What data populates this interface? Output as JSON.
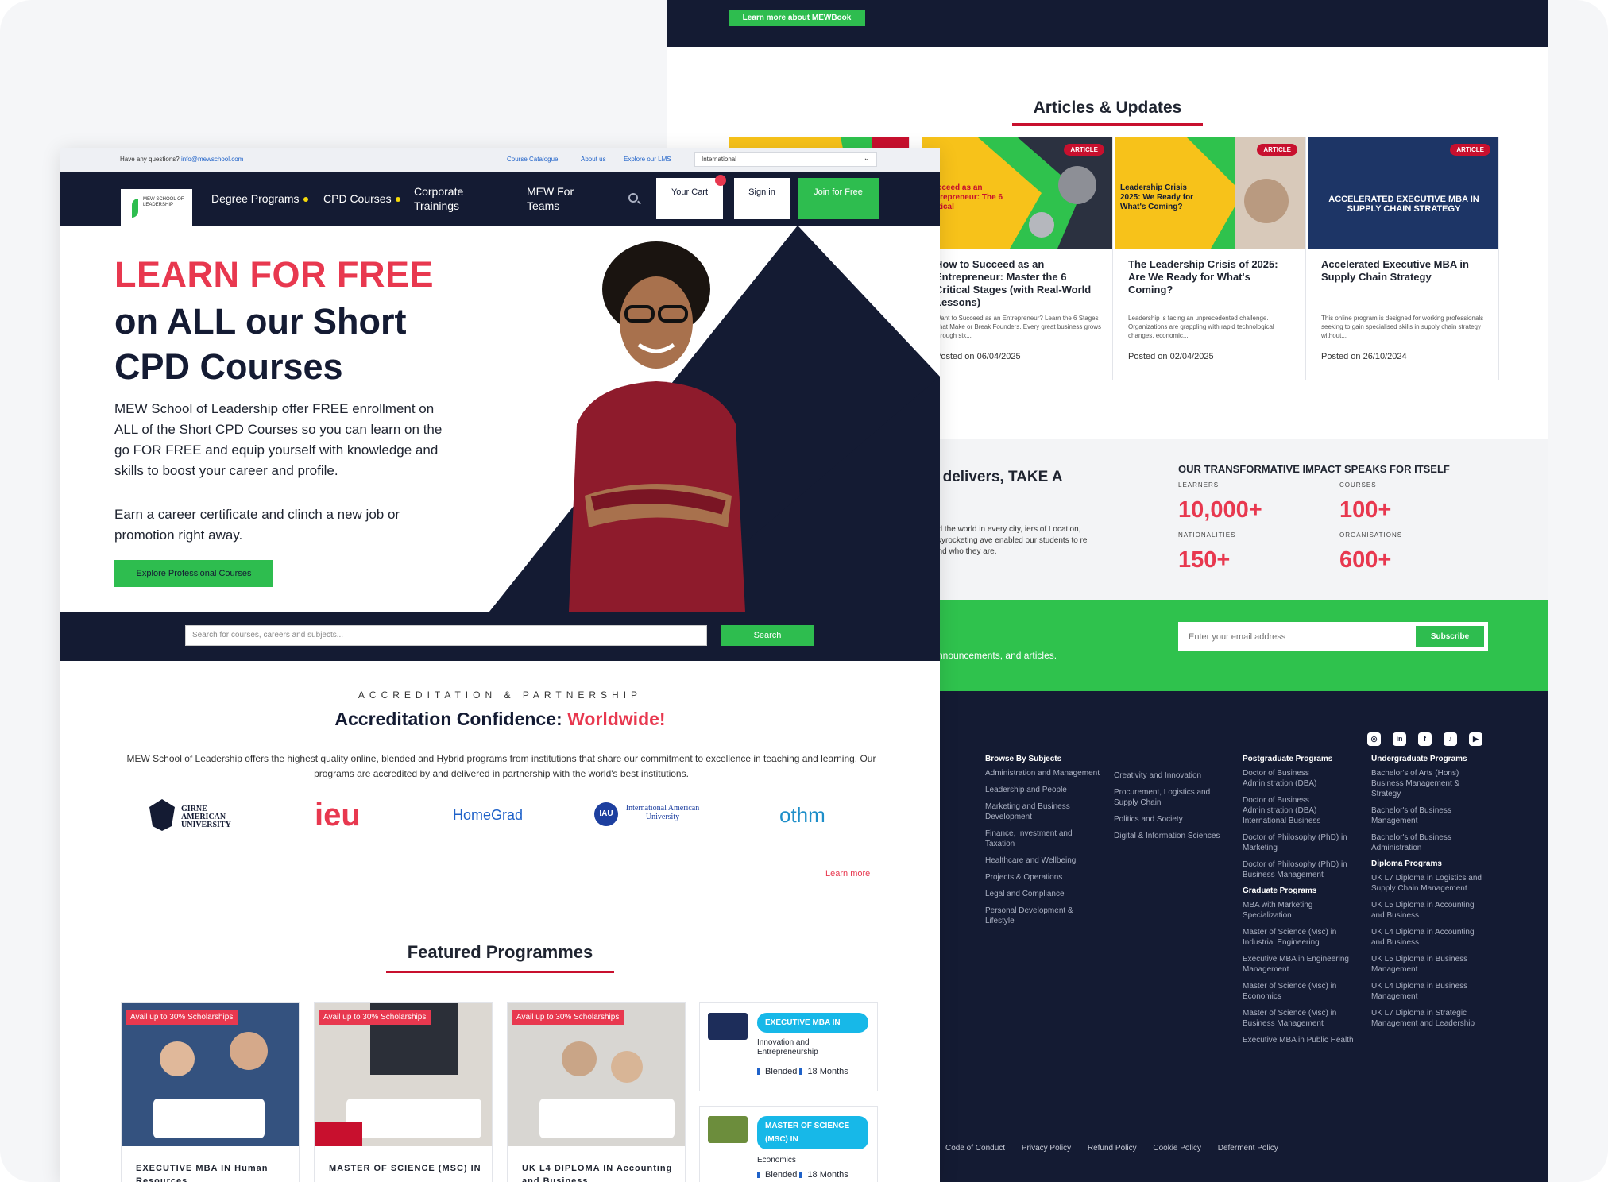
{
  "back_page": {
    "top_button": "Learn more about MEWBook",
    "articles_title": "Articles & Updates",
    "articles": [
      {
        "badge": "ARTICLE",
        "overlay": "Succeed as an Entrepreneur: The 6 Critical",
        "title": "How to Succeed as an Entrepreneur: Master the 6 Critical Stages (with Real-World Lessons)",
        "excerpt": "Want to Succeed as an Entrepreneur? Learn the 6 Stages That Make or Break Founders. Every great business grows through six...",
        "date": "Posted on 06/04/2025"
      },
      {
        "badge": "ARTICLE",
        "overlay": "Leadership Crisis 2025: We Ready for What's Coming?",
        "title": "The Leadership Crisis of 2025: Are We Ready for What's Coming?",
        "excerpt": "Leadership is facing an unprecedented challenge. Organizations are grappling with rapid technological changes, economic...",
        "date": "Posted on 02/04/2025"
      },
      {
        "badge": "ARTICLE",
        "overlay": "ACCELERATED EXECUTIVE MBA IN SUPPLY CHAIN STRATEGY",
        "title": "Accelerated Executive MBA in Supply Chain Strategy",
        "excerpt": "This online program is designed for working professionals seeking to gain specialised skills in supply chain strategy without...",
        "date": "Posted on 26/10/2024"
      }
    ],
    "impact_left_title": "t delivers, TAKE A",
    "impact_left_desc": "nd the world in every city, iers of Location, skyrocketing ave enabled our students to re and who they are.",
    "impact_title": "OUR TRANSFORMATIVE IMPACT SPEAKS FOR ITSELF",
    "stats": [
      {
        "label": "LEARNERS",
        "value": "10,000+"
      },
      {
        "label": "COURSES",
        "value": "100+"
      },
      {
        "label": "NATIONALITIES",
        "value": "150+"
      },
      {
        "label": "ORGANISATIONS",
        "value": "600+"
      }
    ],
    "newsletter_left": "nnouncements, and articles.",
    "newsletter_placeholder": "Enter your email address",
    "newsletter_button": "Subscribe",
    "social_icons": [
      "instagram-icon",
      "linkedin-icon",
      "facebook-icon",
      "tiktok-icon",
      "youtube-icon"
    ],
    "footer": {
      "subjects_title": "Browse By Subjects",
      "subjects_col1": [
        "Administration and Management",
        "Leadership and People",
        "Marketing and Business Development",
        "Finance, Investment and Taxation",
        "Healthcare and Wellbeing",
        "Projects & Operations",
        "Legal and Compliance",
        "Personal Development & Lifestyle"
      ],
      "subjects_col2": [
        "Creativity and Innovation",
        "Procurement, Logistics and Supply Chain",
        "Politics and Society",
        "Digital & Information Sciences"
      ],
      "postgrad_title": "Postgraduate Programs",
      "postgrad": [
        "Doctor of Business Administration (DBA)",
        "Doctor of Business Administration (DBA) International Business",
        "Doctor of Philosophy (PhD) in Marketing",
        "Doctor of Philosophy (PhD) in Business Management"
      ],
      "grad_title": "Graduate Programs",
      "grad": [
        "MBA with Marketing Specialization",
        "Master of Science (Msc) in Industrial Engineering",
        "Executive MBA in Engineering Management",
        "Master of Science (Msc) in Economics",
        "Master of Science (Msc) in Business Management",
        "Executive MBA in Public Health"
      ],
      "undergrad_title": "Undergraduate Programs",
      "undergrad": [
        "Bachelor's of Arts (Hons) Business Management & Strategy",
        "Bachelor's of Business Management",
        "Bachelor's of Business Administration"
      ],
      "diploma_title": "Diploma Programs",
      "diploma": [
        "UK L7 Diploma in Logistics and Supply Chain Management",
        "UK L5 Diploma in Accounting and Business",
        "UK L4 Diploma in Accounting and Business",
        "UK L5 Diploma in Business Management",
        "UK L4 Diploma in Business Management",
        "UK L7 Diploma in Strategic Management and Leadership"
      ],
      "links": [
        "Code of Conduct",
        "Privacy Policy",
        "Refund Policy",
        "Cookie Policy",
        "Deferment Policy"
      ]
    }
  },
  "front_page": {
    "util": {
      "question": "Have any questions?",
      "email": "info@mewschool.com",
      "links": [
        "Course Catalogue",
        "About us",
        "Explore our LMS"
      ],
      "country": "International"
    },
    "nav": {
      "logo_text": "MEW SCHOOL OF LEADERSHIP",
      "degree": "Degree Programs",
      "cpd": "CPD Courses",
      "corporate": "Corporate Trainings",
      "teams": "MEW For Teams",
      "cart": "Your Cart",
      "signin": "Sign in",
      "join": "Join for Free"
    },
    "hero": {
      "title_red": "LEARN FOR FREE",
      "title_dark": "on ALL our Short CPD Courses",
      "para1": "MEW School of Leadership offer FREE enrollment on ALL of the Short CPD Courses so you can learn on the go FOR FREE and equip yourself with knowledge and skills to boost your career and profile.",
      "para2": "Earn a career certificate and clinch a new job or promotion right away.",
      "button": "Explore Professional Courses"
    },
    "search": {
      "placeholder": "Search for courses, careers and subjects...",
      "button": "Search"
    },
    "accreditation": {
      "kicker": "ACCREDITATION & PARTNERSHIP",
      "title": "Accreditation Confidence: ",
      "title_red": "Worldwide!",
      "desc": "MEW School of Leadership offers the highest quality online, blended and Hybrid programs from institutions that share our commitment to excellence in teaching and learning. Our programs are accredited by and delivered in partnership with the world's best institutions.",
      "partners": [
        "GIRNE AMERICAN UNIVERSITY",
        "ieu",
        "HomeGrad",
        "International American University",
        "othm"
      ],
      "learn_more": "Learn more"
    },
    "featured": {
      "title": "Featured Programmes",
      "cards": [
        {
          "badge": "Avail up to 30% Scholarships",
          "title": "EXECUTIVE MBA IN Human Resources"
        },
        {
          "badge": "Avail up to 30% Scholarships",
          "title": "MASTER OF SCIENCE (MSC) IN"
        },
        {
          "badge": "Avail up to 30% Scholarships",
          "title": "UK L4 DIPLOMA IN Accounting and Business"
        }
      ],
      "mini": [
        {
          "pill": "EXECUTIVE MBA IN",
          "sub": "Innovation and Entrepreneurship",
          "mode": "Blended",
          "duration": "18 Months"
        },
        {
          "pill": "MASTER OF SCIENCE (MSC) IN",
          "sub": "Economics",
          "mode": "Blended",
          "duration": "18 Months"
        }
      ]
    }
  }
}
